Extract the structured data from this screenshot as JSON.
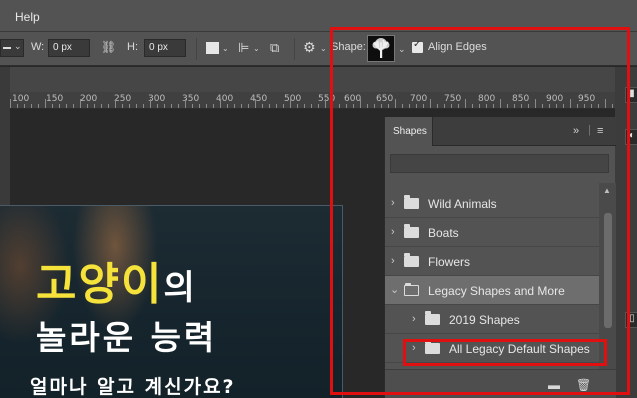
{
  "menubar": {
    "items": [
      {
        "label": "Help"
      }
    ]
  },
  "options": {
    "w_label": "W:",
    "w_value": "0 px",
    "h_label": "H:",
    "h_value": "0 px",
    "shape_label": "Shape:",
    "align_edges_label": "Align Edges",
    "align_edges_checked": true
  },
  "ruler": {
    "marks": [
      "100",
      "150",
      "200",
      "250",
      "300",
      "350",
      "400",
      "450",
      "500",
      "550",
      "600",
      "650",
      "700",
      "750",
      "800",
      "850",
      "900",
      "950"
    ]
  },
  "artwork": {
    "line1_part1": "고양이",
    "line1_part2": "의",
    "line2": "놀라운 능력",
    "line3": "얼마나 알고 계신가요?",
    "accent_color": "#f5e23a"
  },
  "panel": {
    "tab_label": "Shapes",
    "search_placeholder": "",
    "items": [
      {
        "label": "Wild Animals",
        "level": 0,
        "expanded": false
      },
      {
        "label": "Boats",
        "level": 0,
        "expanded": false
      },
      {
        "label": "Flowers",
        "level": 0,
        "expanded": false
      },
      {
        "label": "Legacy Shapes and More",
        "level": 0,
        "expanded": true,
        "selected": true
      },
      {
        "label": "2019 Shapes",
        "level": 1,
        "expanded": false
      },
      {
        "label": "All Legacy Default Shapes",
        "level": 1,
        "expanded": false
      }
    ]
  },
  "annotation_color": "#e01010"
}
